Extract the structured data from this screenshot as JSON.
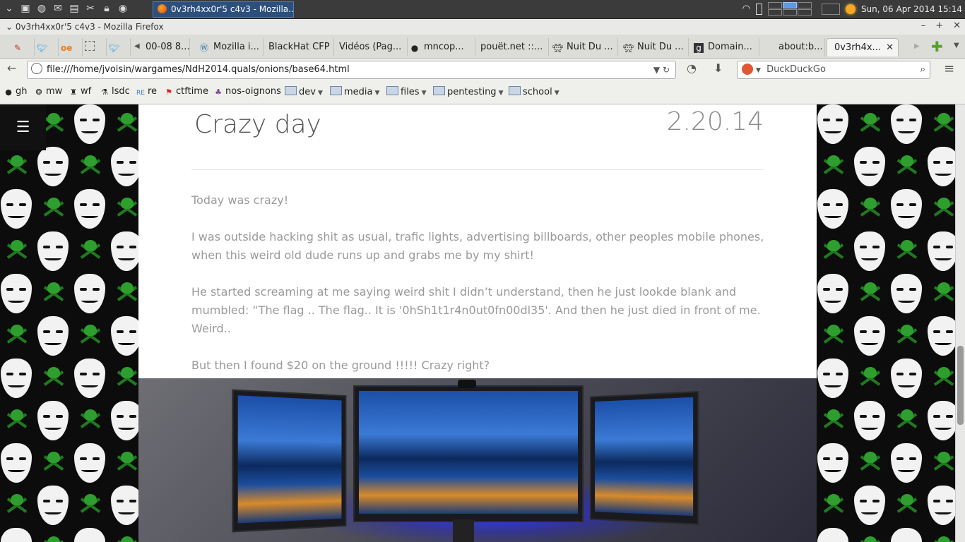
{
  "taskbar": {
    "active_window": "0v3rh4xx0r'5 c4v3 - Mozilla...",
    "clock": "Sun, 06 Apr 2014 15:14"
  },
  "browser": {
    "window_title": "0v3rh4xx0r'5 c4v3 - Mozilla Firefox",
    "tabs": [
      {
        "label": "",
        "icon": "brush-icon"
      },
      {
        "label": "",
        "icon": "twitter-icon"
      },
      {
        "label": "",
        "icon": "oe-icon"
      },
      {
        "label": "",
        "icon": "blank-page-icon"
      },
      {
        "label": "",
        "icon": "twitter-icon"
      },
      {
        "label": "00-08 8...",
        "icon": ""
      },
      {
        "label": "Mozilla i...",
        "icon": "wordpress-icon"
      },
      {
        "label": "BlackHat CFP",
        "icon": ""
      },
      {
        "label": "Vidéos (Pag...",
        "icon": ""
      },
      {
        "label": "mncop...",
        "icon": "github-icon"
      },
      {
        "label": "pouët.net ::...",
        "icon": ""
      },
      {
        "label": "Nuit Du ...",
        "icon": "space-invader-icon"
      },
      {
        "label": "Nuit Du ...",
        "icon": "space-invader-icon"
      },
      {
        "label": "Domain...",
        "icon": "gandi-icon"
      },
      {
        "label": "about:b...",
        "icon": ""
      },
      {
        "label": "0v3rh4x...",
        "icon": ""
      }
    ],
    "url": "file:///home/jvoisin/wargames/NdH2014.quals/onions/base64.html",
    "search_placeholder": "DuckDuckGo",
    "bookmarks": [
      {
        "label": "gh",
        "type": "link"
      },
      {
        "label": "mw",
        "type": "link"
      },
      {
        "label": "wf",
        "type": "link"
      },
      {
        "label": "lsdc",
        "type": "link"
      },
      {
        "label": "re",
        "type": "link"
      },
      {
        "label": "ctftime",
        "type": "link"
      },
      {
        "label": "nos-oignons",
        "type": "link"
      },
      {
        "label": "dev",
        "type": "folder"
      },
      {
        "label": "media",
        "type": "folder"
      },
      {
        "label": "files",
        "type": "folder"
      },
      {
        "label": "pentesting",
        "type": "folder"
      },
      {
        "label": "school",
        "type": "folder"
      }
    ]
  },
  "page": {
    "menu_icon": "hamburger-icon",
    "post": {
      "title": "Crazy day",
      "date": "2.20.14",
      "paragraphs": [
        "Today was crazy!",
        "I was outside hacking shit as usual, trafic lights, advertising billboards, other peoples mobile phones, when this weird old dude runs up and grabs me by my shirt!",
        "He started screaming at me saying weird shit I didn’t understand, then he just lookde blank and mumbled: “The flag .. The flag.. It is '0hSh1t1r4n0ut0fn00dl35'. And then he just died in front of me. Weird..",
        "But then I found $20 on the ground !!!!! Crazy right?"
      ]
    }
  },
  "colors": {
    "taskbar_bg": "#3b3b3b",
    "page_text": "#9a9a9a",
    "title_text": "#555555",
    "pattern_green": "#2e9e2e"
  }
}
